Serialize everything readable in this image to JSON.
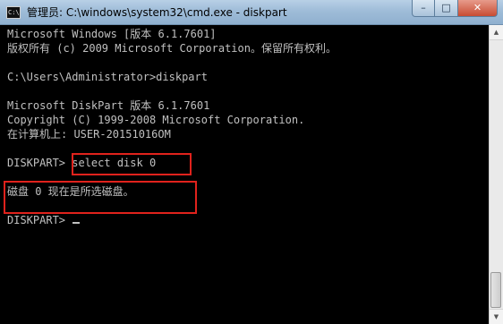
{
  "window": {
    "icon_text": "C:\\",
    "title": "管理员: C:\\windows\\system32\\cmd.exe - diskpart",
    "buttons": {
      "minimize": "–",
      "maximize": "□",
      "close": "✕"
    }
  },
  "console": {
    "lines": [
      "Microsoft Windows [版本 6.1.7601]",
      "版权所有 (c) 2009 Microsoft Corporation。保留所有权利。",
      "",
      "C:\\Users\\Administrator>diskpart",
      "",
      "Microsoft DiskPart 版本 6.1.7601",
      "Copyright (C) 1999-2008 Microsoft Corporation.",
      "在计算机上: USER-20151016OM",
      "",
      "DISKPART> select disk 0",
      "",
      "磁盘 0 现在是所选磁盘。",
      "",
      "DISKPART> "
    ]
  },
  "scrollbar": {
    "up_arrow": "▲",
    "down_arrow": "▼"
  },
  "colors": {
    "console_background": "#000000",
    "console_text": "#c0c0c0",
    "highlight_border": "#e0221c"
  }
}
